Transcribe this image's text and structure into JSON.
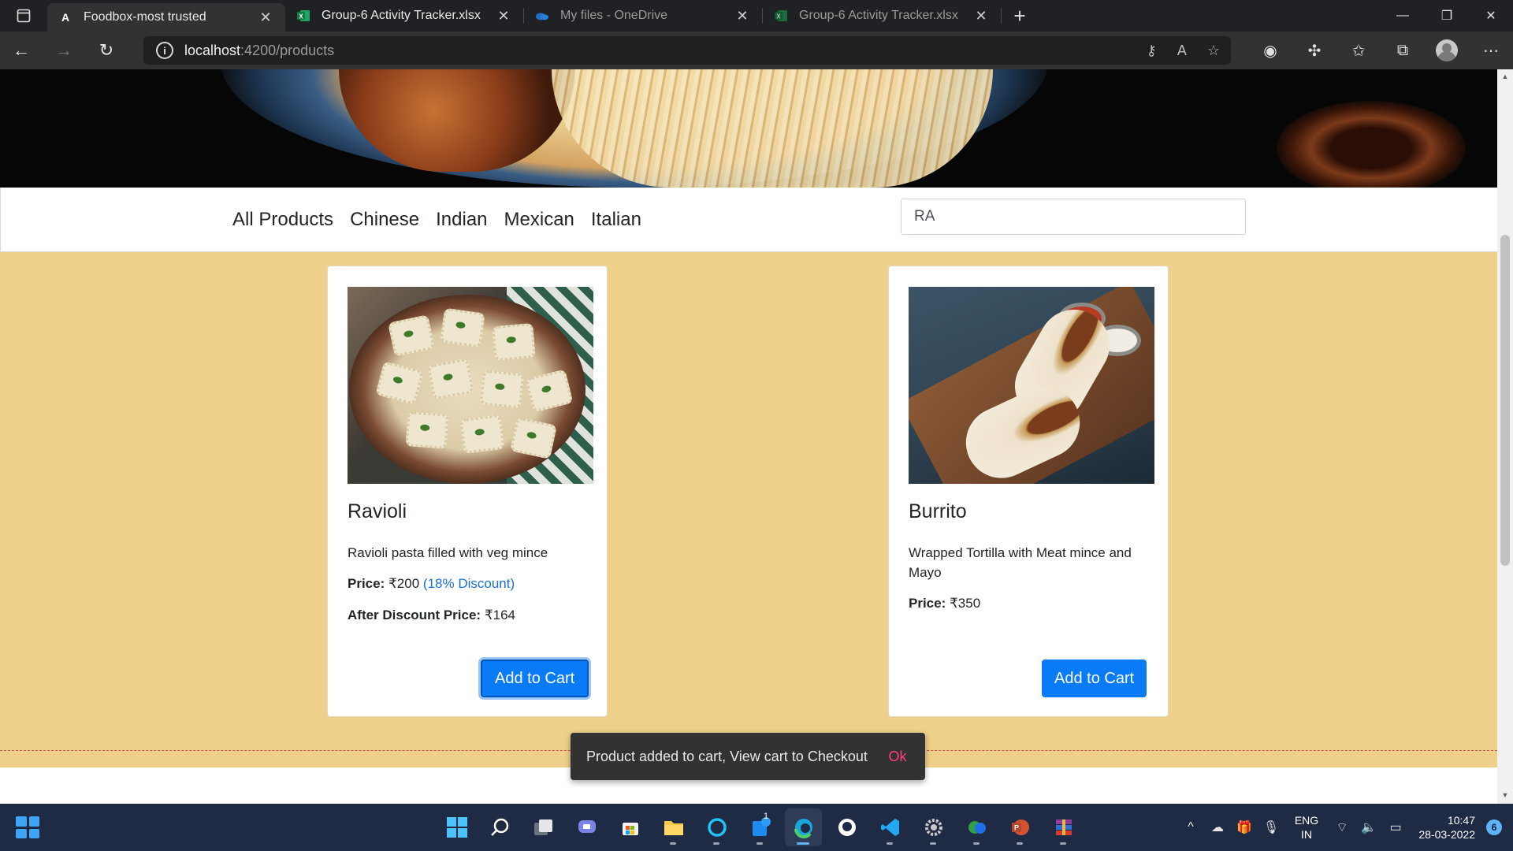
{
  "browser": {
    "tabs": [
      {
        "title": "Foodbox-most trusted",
        "icon": "angular-icon",
        "active": true
      },
      {
        "title": "Group-6 Activity Tracker.xlsx",
        "icon": "excel-icon",
        "active": false
      },
      {
        "title": "My files - OneDrive",
        "icon": "onedrive-icon",
        "active": false
      },
      {
        "title": "Group-6 Activity Tracker.xlsx",
        "icon": "excel-icon",
        "active": false
      }
    ],
    "url_host": "localhost",
    "url_path": ":4200/products"
  },
  "nav": {
    "categories": [
      "All Products",
      "Chinese",
      "Indian",
      "Mexican",
      "Italian"
    ],
    "search_value": "RA"
  },
  "products": [
    {
      "name": "Ravioli",
      "description": "Ravioli pasta filled with veg mince",
      "price_label": "Price:",
      "price": "₹200",
      "discount": "(18% Discount)",
      "after_label": "After Discount Price:",
      "after_price": "₹164",
      "button": "Add to Cart"
    },
    {
      "name": "Burrito",
      "description": "Wrapped Tortilla with Meat mince and Mayo",
      "price_label": "Price:",
      "price": "₹350",
      "button": "Add to Cart"
    }
  ],
  "snackbar": {
    "message": "Product added to cart, View cart to Checkout",
    "action": "Ok"
  },
  "taskbar": {
    "lang_line1": "ENG",
    "lang_line2": "IN",
    "time": "10:47",
    "date": "28-03-2022",
    "notifications": "6",
    "edge_badge": "1"
  },
  "colors": {
    "products_bg": "#efd08a",
    "button": "#0a7bf7",
    "discount_text": "#1a6fd6",
    "snack_action": "#ff4081"
  }
}
